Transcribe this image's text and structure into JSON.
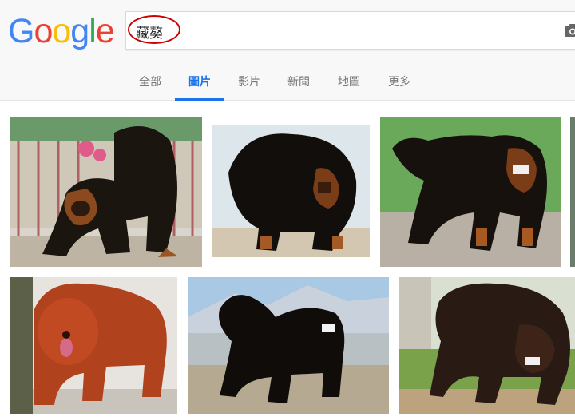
{
  "logo": {
    "letters": [
      "G",
      "o",
      "o",
      "g",
      "l",
      "e"
    ],
    "colors": [
      "#4285F4",
      "#EA4335",
      "#FBBC05",
      "#4285F4",
      "#34A853",
      "#EA4335"
    ]
  },
  "search": {
    "query": "藏獒",
    "highlight_color": "#cc0000"
  },
  "icons": {
    "camera": "camera-icon"
  },
  "tabs": [
    {
      "label": "全部",
      "active": false
    },
    {
      "label": "圖片",
      "active": true
    },
    {
      "label": "影片",
      "active": false
    },
    {
      "label": "新聞",
      "active": false
    },
    {
      "label": "地圖",
      "active": false
    },
    {
      "label": "更多",
      "active": false
    }
  ],
  "colors": {
    "accent": "#1a73e8"
  },
  "results": [
    {
      "subject": "black-and-tan dog in garden"
    },
    {
      "subject": "black dog with tan face"
    },
    {
      "subject": "black-and-tan dog on gravel"
    },
    {
      "subject": "red dog"
    },
    {
      "subject": "black dog with mountains behind"
    },
    {
      "subject": "black dog on grass"
    }
  ]
}
